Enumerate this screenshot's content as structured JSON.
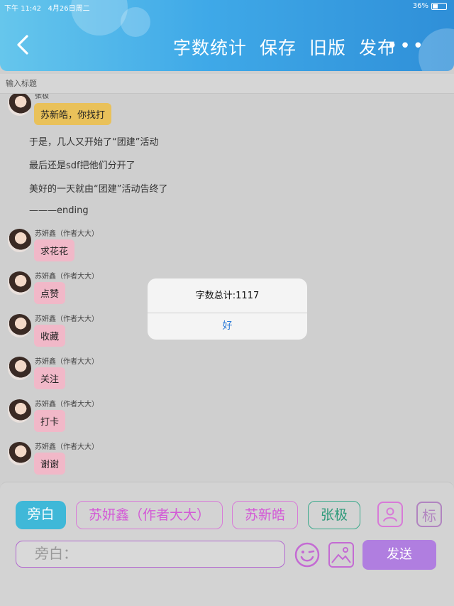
{
  "status_bar": {
    "time": "下午 11:42",
    "date": "4月26日周二",
    "battery": "36%"
  },
  "header": {
    "actions": [
      "字数统计",
      "保存",
      "旧版",
      "发布"
    ],
    "more": "•••"
  },
  "title_input": {
    "placeholder": "输入标题"
  },
  "messages": [
    {
      "sender": "张极",
      "text": "苏新皓，你找打"
    },
    {
      "narration": "于是，几人又开始了“团建”活动"
    },
    {
      "narration": "最后还是sdf把他们分开了"
    },
    {
      "narration": "美好的一天就由“团建”活动告终了"
    },
    {
      "narration": "———ending"
    },
    {
      "sender": "苏妍鑫（作者大大）",
      "text": "求花花"
    },
    {
      "sender": "苏妍鑫（作者大大）",
      "text": "点赞"
    },
    {
      "sender": "苏妍鑫（作者大大）",
      "text": "收藏"
    },
    {
      "sender": "苏妍鑫（作者大大）",
      "text": "关注"
    },
    {
      "sender": "苏妍鑫（作者大大）",
      "text": "打卡"
    },
    {
      "sender": "苏妍鑫（作者大大）",
      "text": "谢谢"
    }
  ],
  "dialog": {
    "message": "字数总计:1117",
    "ok": "好"
  },
  "bottom": {
    "roles": [
      "旁白",
      "苏妍鑫（作者大大）",
      "苏新皓",
      "张极"
    ],
    "tag_icon": "标",
    "input_placeholder": "旁白：",
    "send": "发送"
  },
  "colors": {
    "header": "#3fa9e8",
    "pink_bubble": "#f1b8c8",
    "yellow_bubble": "#e9c15a",
    "send": "#b07ee0",
    "dialog_ok": "#2a7ad8"
  }
}
